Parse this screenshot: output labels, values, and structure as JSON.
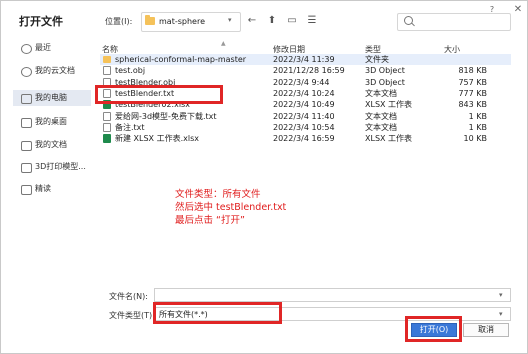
{
  "dialog": {
    "title": "打开文件",
    "help_glyph": "?",
    "close_glyph": "✕"
  },
  "location": {
    "label": "位置(I):",
    "folder": "mat-sphere",
    "search_placeholder": ""
  },
  "sidebar": {
    "items": [
      {
        "label": "最近",
        "icon": "clock-icon"
      },
      {
        "label": "我的云文档",
        "icon": "cloud-icon"
      },
      {
        "label": "我的电脑",
        "icon": "computer-icon",
        "active": true
      },
      {
        "label": "我的桌面",
        "icon": "desktop-icon"
      },
      {
        "label": "我的文档",
        "icon": "document-icon"
      },
      {
        "label": "3D打印模型...",
        "icon": "folder-icon"
      },
      {
        "label": "精读",
        "icon": "folder-icon"
      }
    ]
  },
  "columns": {
    "name": "名称",
    "modified": "修改日期",
    "type": "类型",
    "size": "大小"
  },
  "files": [
    {
      "name": "spherical-conformal-map-master",
      "date": "2022/3/4 11:39",
      "type": "文件夹",
      "size": "",
      "icon": "folder"
    },
    {
      "name": "test.obj",
      "date": "2021/12/28 16:59",
      "type": "3D Object",
      "size": "818 KB",
      "icon": "obj"
    },
    {
      "name": "testBlender.obj",
      "date": "2022/3/4 9:44",
      "type": "3D Object",
      "size": "757 KB",
      "icon": "obj"
    },
    {
      "name": "testBlender.txt",
      "date": "2022/3/4 10:24",
      "type": "文本文档",
      "size": "777 KB",
      "icon": "doc"
    },
    {
      "name": "testBlender02.xlsx",
      "date": "2022/3/4 10:49",
      "type": "XLSX 工作表",
      "size": "843 KB",
      "icon": "xlsx"
    },
    {
      "name": "爱给网-3d模型-免费下载.txt",
      "date": "2022/3/4 11:40",
      "type": "文本文档",
      "size": "1 KB",
      "icon": "doc"
    },
    {
      "name": "备注.txt",
      "date": "2022/3/4 10:54",
      "type": "文本文档",
      "size": "1 KB",
      "icon": "doc"
    },
    {
      "name": "新建 XLSX 工作表.xlsx",
      "date": "2022/3/4 16:59",
      "type": "XLSX 工作表",
      "size": "10 KB",
      "icon": "xlsx"
    }
  ],
  "annotation": {
    "line1": "文件类型：所有文件",
    "line2": "然后选中 testBlender.txt",
    "line3": "最后点击 “打开”"
  },
  "bottom": {
    "filename_label": "文件名(N):",
    "filename_value": "",
    "filetype_label": "文件类型(T):",
    "filetype_value": "所有文件(*.*)",
    "open_label": "打开(O)",
    "cancel_label": "取消"
  },
  "colors": {
    "accent": "#3a78d8",
    "annotation": "#e01c1c",
    "selection": "#e6eefb"
  }
}
